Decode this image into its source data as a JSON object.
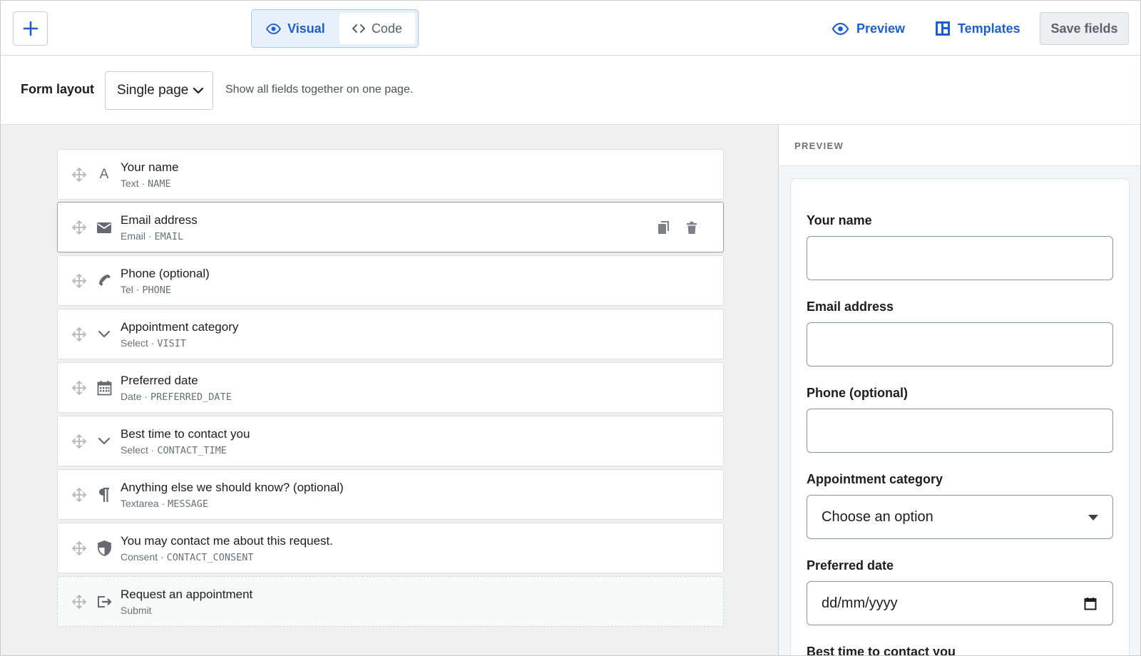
{
  "toolbar": {
    "add_icon": "plus-icon",
    "modes": {
      "visual_label": "Visual",
      "code_label": "Code"
    },
    "preview_label": "Preview",
    "templates_label": "Templates",
    "save_label": "Save fields",
    "accent_color": "#1b5fd1"
  },
  "layout": {
    "label": "Form layout",
    "selected": "Single page",
    "hint": "Show all fields together on one page."
  },
  "fields": [
    {
      "title": "Your name",
      "type": "Text",
      "key": "NAME",
      "icon": "text-icon"
    },
    {
      "title": "Email address",
      "type": "Email",
      "key": "EMAIL",
      "icon": "envelope-icon"
    },
    {
      "title": "Phone (optional)",
      "type": "Tel",
      "key": "PHONE",
      "icon": "phone-icon"
    },
    {
      "title": "Appointment category",
      "type": "Select",
      "key": "VISIT",
      "icon": "chevron-down-icon"
    },
    {
      "title": "Preferred date",
      "type": "Date",
      "key": "PREFERRED_DATE",
      "icon": "calendar-icon"
    },
    {
      "title": "Best time to contact you",
      "type": "Select",
      "key": "CONTACT_TIME",
      "icon": "chevron-down-icon"
    },
    {
      "title": "Anything else we should know? (optional)",
      "type": "Textarea",
      "key": "MESSAGE",
      "icon": "paragraph-icon"
    },
    {
      "title": "You may contact me about this request.",
      "type": "Consent",
      "key": "CONTACT_CONSENT",
      "icon": "shield-icon"
    },
    {
      "title": "Request an appointment",
      "type": "Submit",
      "key": "",
      "icon": "submit-icon"
    }
  ],
  "field_meta_separator": " · ",
  "preview": {
    "heading": "PREVIEW",
    "fields": [
      {
        "label": "Your name",
        "value": ""
      },
      {
        "label": "Email address",
        "value": ""
      },
      {
        "label": "Phone (optional)",
        "value": ""
      },
      {
        "label": "Appointment category",
        "value": "Choose an option"
      },
      {
        "label": "Preferred date",
        "value": "dd/mm/yyyy"
      },
      {
        "label": "Best time to contact you",
        "value": ""
      }
    ]
  }
}
